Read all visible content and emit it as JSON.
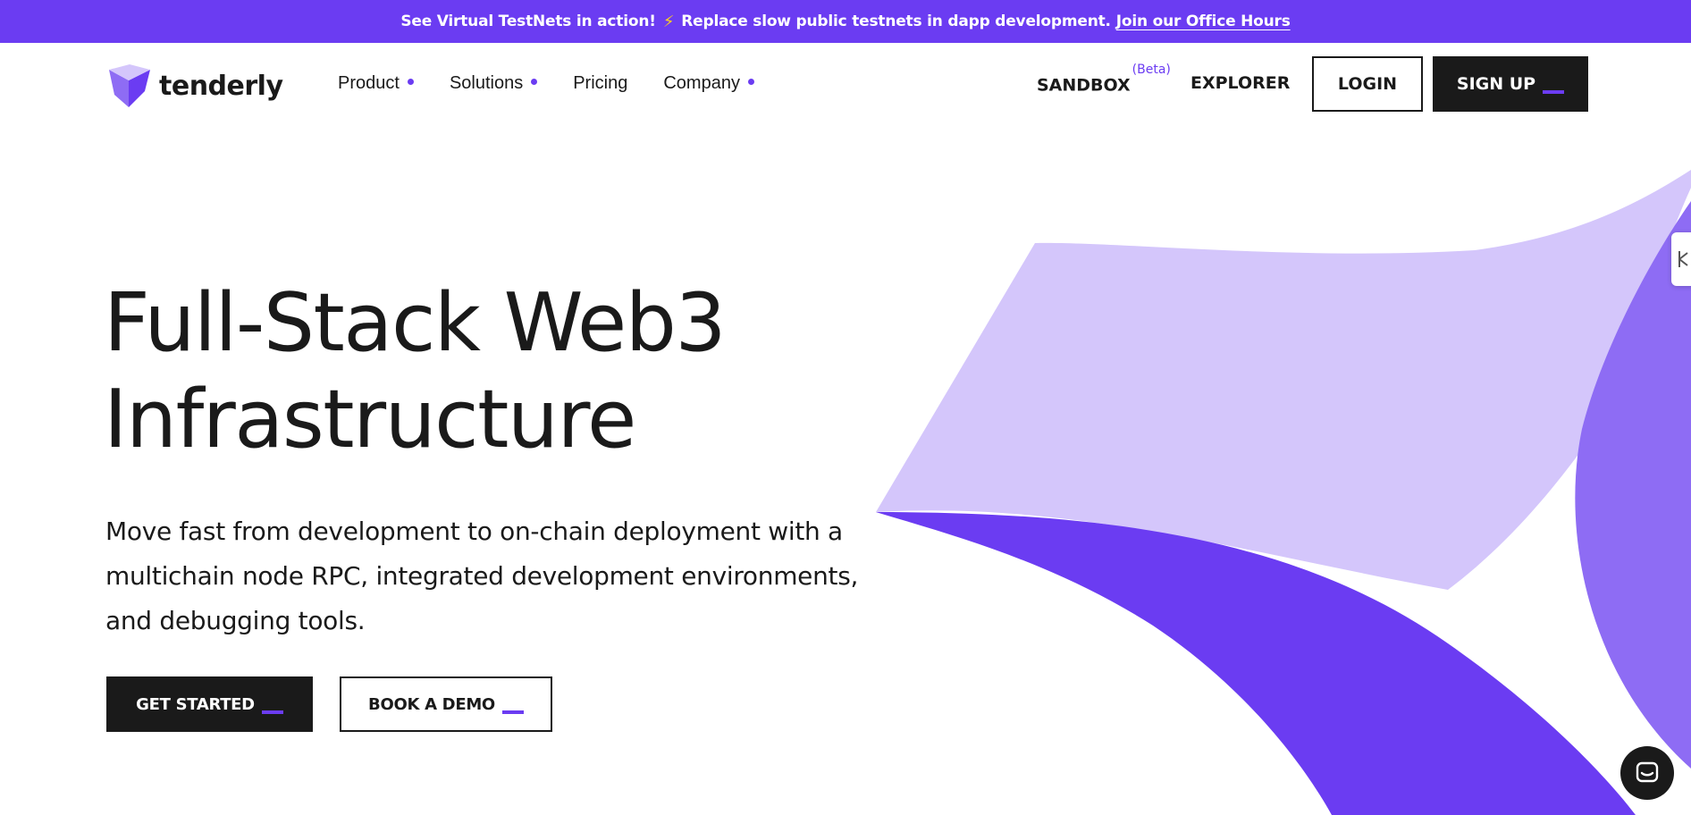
{
  "banner": {
    "text": "See Virtual TestNets in action!",
    "bolt": "⚡",
    "text2": "Replace slow public testnets in dapp development.",
    "link": "Join our Office Hours"
  },
  "nav": {
    "logo": "tenderly",
    "menu": [
      {
        "label": "Product",
        "has_dot": true
      },
      {
        "label": "Solutions",
        "has_dot": true
      },
      {
        "label": "Pricing",
        "has_dot": false
      },
      {
        "label": "Company",
        "has_dot": true
      }
    ],
    "sandbox": "SANDBOX",
    "sandbox_badge": "(Beta)",
    "explorer": "EXPLORER",
    "login": "LOGIN",
    "signup": "SIGN UP"
  },
  "hero": {
    "headline_line1": "Full-Stack Web3",
    "headline_line2": "Infrastructure",
    "subtext": "Move fast from development to on-chain deployment with a multichain node RPC, integrated development environments, and debugging tools.",
    "cta_primary": "GET STARTED",
    "cta_secondary": "BOOK A DEMO"
  },
  "colors": {
    "brand": "#6b3cf2",
    "brand_light": "#d4c6fb",
    "brand_mid": "#8e6cf4",
    "dark": "#1a1a1a"
  },
  "icons": {
    "logo": "tenderly-logo-icon",
    "side_tab": "toolbar-icon",
    "chat": "chat-icon"
  }
}
